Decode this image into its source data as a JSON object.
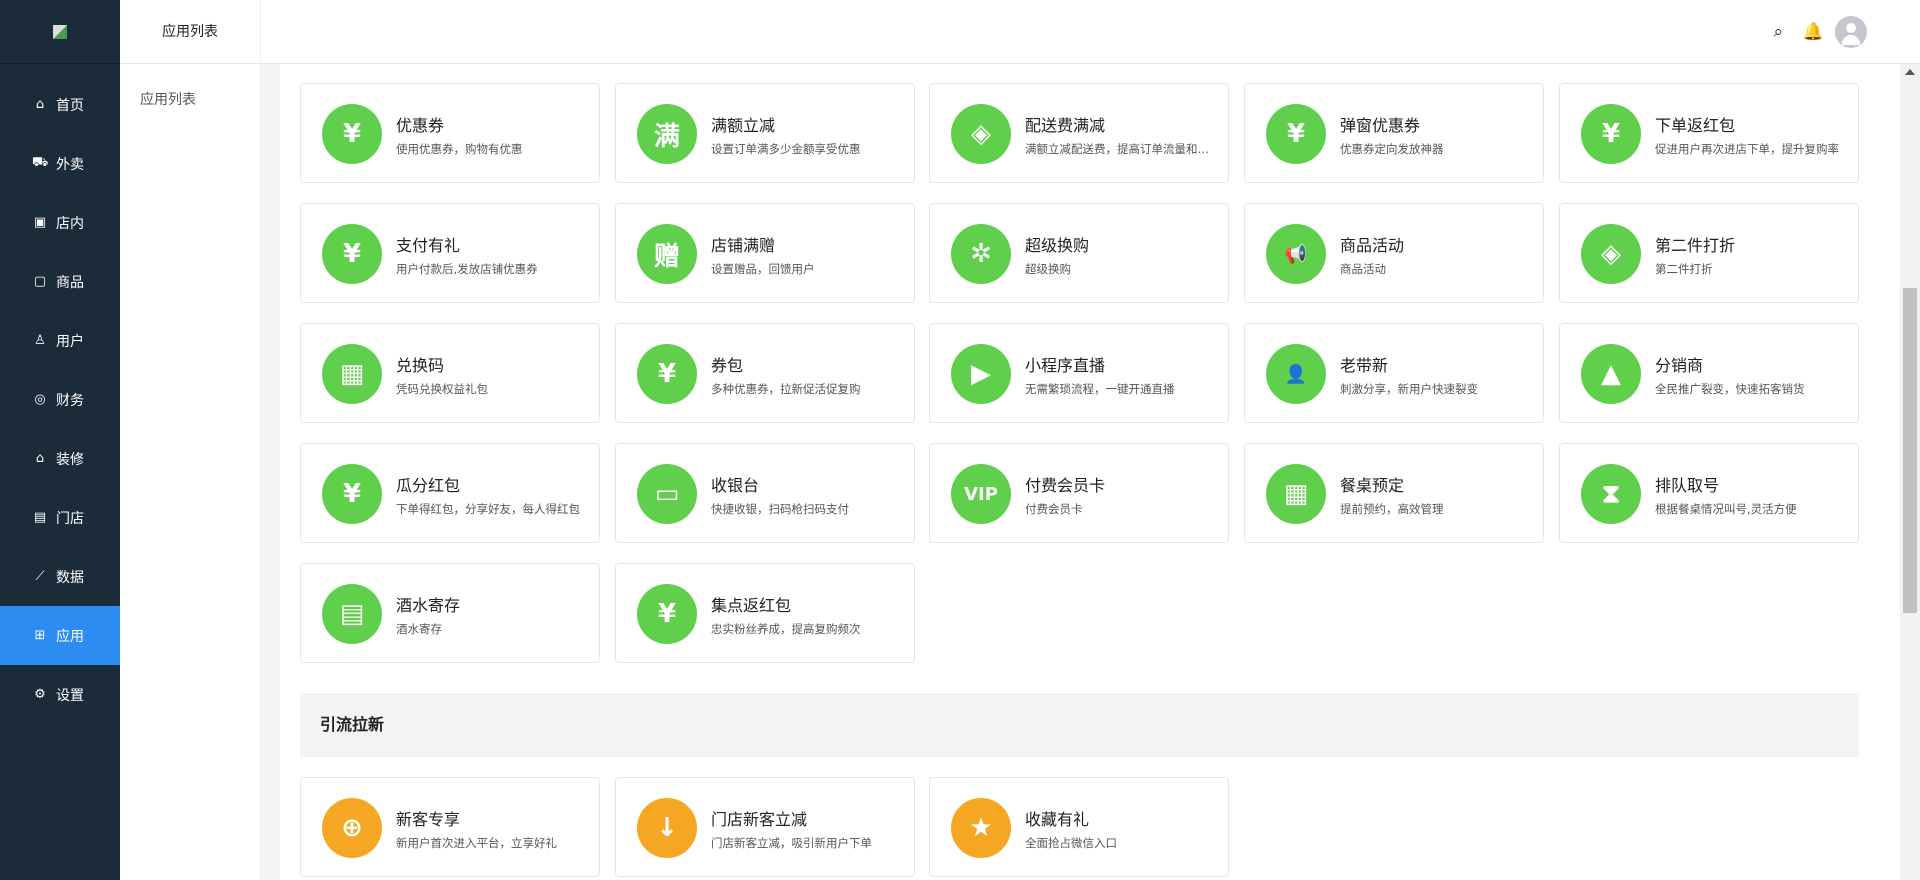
{
  "sidebar": {
    "items": [
      {
        "label": "首页",
        "icon": "home-icon",
        "glyph": "⌂"
      },
      {
        "label": "外卖",
        "icon": "delivery-icon",
        "glyph": "⛟"
      },
      {
        "label": "店内",
        "icon": "store-in-icon",
        "glyph": "▣"
      },
      {
        "label": "商品",
        "icon": "goods-icon",
        "glyph": "▢"
      },
      {
        "label": "用户",
        "icon": "user-icon",
        "glyph": "♙"
      },
      {
        "label": "财务",
        "icon": "finance-icon",
        "glyph": "◎"
      },
      {
        "label": "装修",
        "icon": "decorate-icon",
        "glyph": "⌂"
      },
      {
        "label": "门店",
        "icon": "shop-icon",
        "glyph": "▤"
      },
      {
        "label": "数据",
        "icon": "chart-icon",
        "glyph": "⟋"
      },
      {
        "label": "应用",
        "icon": "apps-icon",
        "glyph": "⊞",
        "active": true
      },
      {
        "label": "设置",
        "icon": "settings-icon",
        "glyph": "⚙"
      }
    ]
  },
  "subnav": {
    "title": "应用列表",
    "item": "应用列表"
  },
  "colors": {
    "green": "#5fcf4c",
    "orange": "#f5a623",
    "active": "#2d8cf0"
  },
  "apps": [
    {
      "title": "优惠券",
      "desc": "使用优惠券，购物有优惠",
      "icon": "coupon-icon",
      "glyph": "¥"
    },
    {
      "title": "满额立减",
      "desc": "设置订单满多少金额享受优惠",
      "icon": "full-reduce-icon",
      "glyph": "满"
    },
    {
      "title": "配送费满减",
      "desc": "满额立减配送费，提高订单流量和…",
      "icon": "tag-icon",
      "glyph": "◈"
    },
    {
      "title": "弹窗优惠券",
      "desc": "优惠券定向发放神器",
      "icon": "popup-coupon-icon",
      "glyph": "¥"
    },
    {
      "title": "下单返红包",
      "desc": "促进用户再次进店下单，提升复购率",
      "icon": "red-packet-icon",
      "glyph": "¥"
    },
    {
      "title": "支付有礼",
      "desc": "用户付款后,发放店铺优惠券",
      "icon": "pay-gift-icon",
      "glyph": "¥"
    },
    {
      "title": "店铺满赠",
      "desc": "设置赠品，回馈用户",
      "icon": "gift-icon",
      "glyph": "赠"
    },
    {
      "title": "超级换购",
      "desc": "超级换购",
      "icon": "wheel-icon",
      "glyph": "✲"
    },
    {
      "title": "商品活动",
      "desc": "商品活动",
      "icon": "megaphone-icon",
      "glyph": "📢"
    },
    {
      "title": "第二件打折",
      "desc": "第二件打折",
      "icon": "discount-tag-icon",
      "glyph": "◈"
    },
    {
      "title": "兑换码",
      "desc": "凭码兑换权益礼包",
      "icon": "redeem-icon",
      "glyph": "▦"
    },
    {
      "title": "券包",
      "desc": "多种优惠券，拉新促活促复购",
      "icon": "coupon-pack-icon",
      "glyph": "¥"
    },
    {
      "title": "小程序直播",
      "desc": "无需繁琐流程，一键开通直播",
      "icon": "live-icon",
      "glyph": "▶"
    },
    {
      "title": "老带新",
      "desc": "刺激分享，新用户快速裂变",
      "icon": "invite-user-icon",
      "glyph": "👤"
    },
    {
      "title": "分销商",
      "desc": "全民推广裂变，快速拓客销货",
      "icon": "distributor-icon",
      "glyph": "▲"
    },
    {
      "title": "瓜分红包",
      "desc": "下单得红包，分享好友，每人得红包",
      "icon": "split-red-packet-icon",
      "glyph": "¥"
    },
    {
      "title": "收银台",
      "desc": "快捷收银，扫码枪扫码支付",
      "icon": "cashier-icon",
      "glyph": "▭"
    },
    {
      "title": "付费会员卡",
      "desc": "付费会员卡",
      "icon": "vip-icon",
      "glyph": "VIP"
    },
    {
      "title": "餐桌预定",
      "desc": "提前预约，高效管理",
      "icon": "calendar-icon",
      "glyph": "▦"
    },
    {
      "title": "排队取号",
      "desc": "根据餐桌情况叫号,灵活方便",
      "icon": "hourglass-icon",
      "glyph": "⧗"
    },
    {
      "title": "酒水寄存",
      "desc": "酒水寄存",
      "icon": "storage-icon",
      "glyph": "▤"
    },
    {
      "title": "集点返红包",
      "desc": "忠实粉丝养成，提高复购频次",
      "icon": "points-red-packet-icon",
      "glyph": "¥"
    }
  ],
  "section2": {
    "title": "引流拉新",
    "apps": [
      {
        "title": "新客专享",
        "desc": "新用户首次进入平台，立享好礼",
        "icon": "new-customer-icon",
        "glyph": "⊕"
      },
      {
        "title": "门店新客立减",
        "desc": "门店新客立减，吸引新用户下单",
        "icon": "badge-down-icon",
        "glyph": "↓"
      },
      {
        "title": "收藏有礼",
        "desc": "全面抢占微信入口",
        "icon": "star-icon",
        "glyph": "★"
      }
    ]
  }
}
